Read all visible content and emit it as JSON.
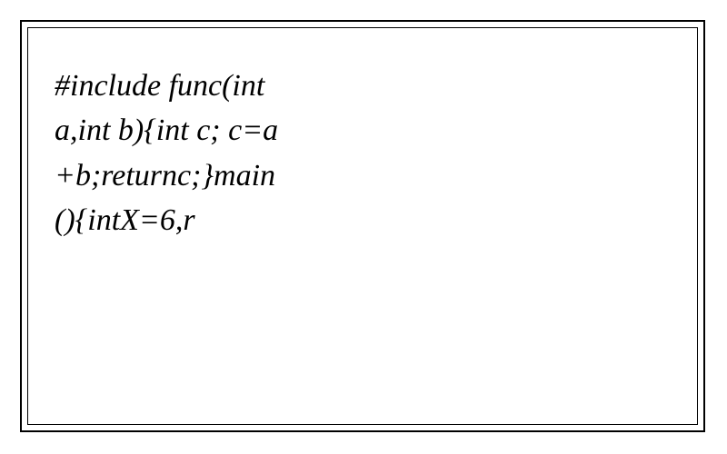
{
  "code_text": "#include func(int a,int b){int c; c=a+b;returnc;}main(){intX=6,r"
}
